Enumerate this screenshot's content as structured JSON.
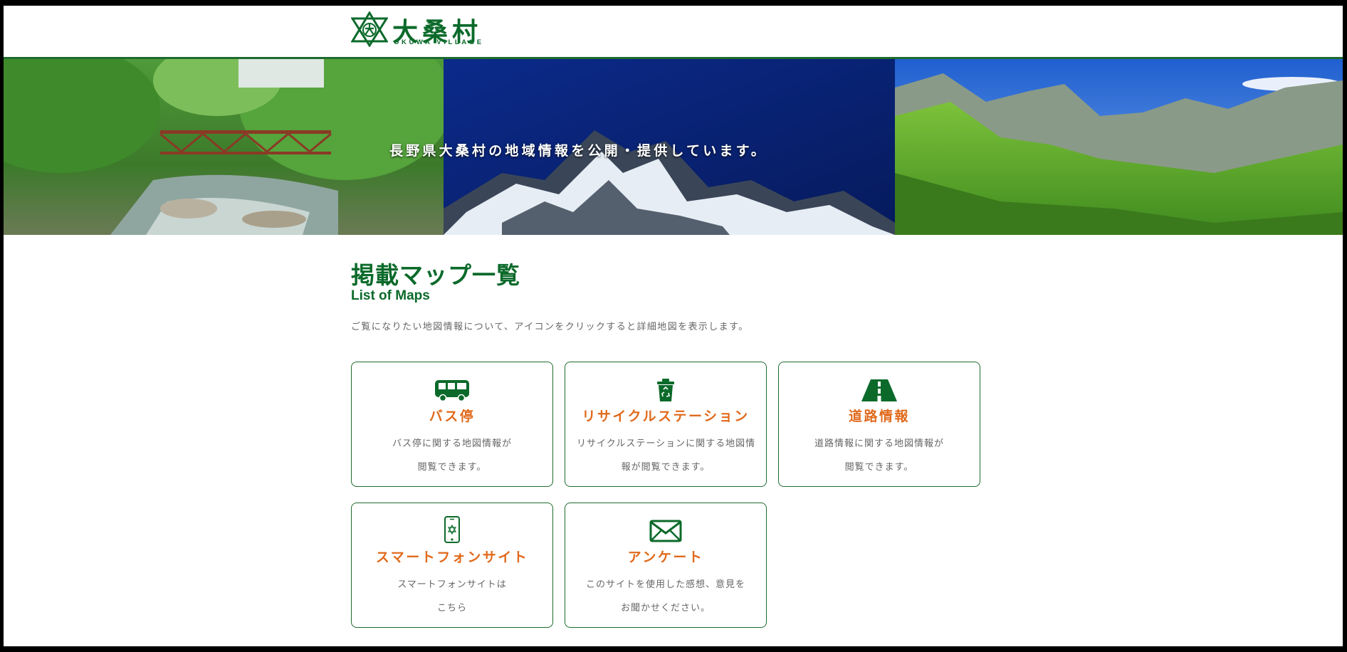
{
  "header": {
    "logo_text": "大桑村",
    "logo_subtext": "OKUWA VILLAGE"
  },
  "hero": {
    "caption": "長野県大桑村の地域情報を公開・提供しています。"
  },
  "main": {
    "title_ja": "掲載マップ一覧",
    "title_en": "List of Maps",
    "intro": "ご覧になりたい地図情報について、アイコンをクリックすると詳細地図を表示します。",
    "cards": [
      {
        "icon": "bus-icon",
        "title": "バス停",
        "desc_line1": "バス停に関する地図情報が",
        "desc_line2": "閲覧できます。"
      },
      {
        "icon": "recycle-bin-icon",
        "title": "リサイクルステーション",
        "desc_line1": "リサイクルステーションに関する地図情",
        "desc_line2": "報が閲覧できます。"
      },
      {
        "icon": "road-icon",
        "title": "道路情報",
        "desc_line1": "道路情報に関する地図情報が",
        "desc_line2": "閲覧できます。"
      },
      {
        "icon": "smartphone-icon",
        "title": "スマートフォンサイト",
        "desc_line1": "スマートフォンサイトは",
        "desc_line2": "こちら"
      },
      {
        "icon": "envelope-icon",
        "title": "アンケート",
        "desc_line1": "このサイトを使用した感想、意見を",
        "desc_line2": "お聞かせください。"
      }
    ]
  },
  "colors": {
    "brand_green": "#0b6a2a",
    "card_title_orange": "#e06a1c",
    "border_green": "#1e6b2e"
  }
}
